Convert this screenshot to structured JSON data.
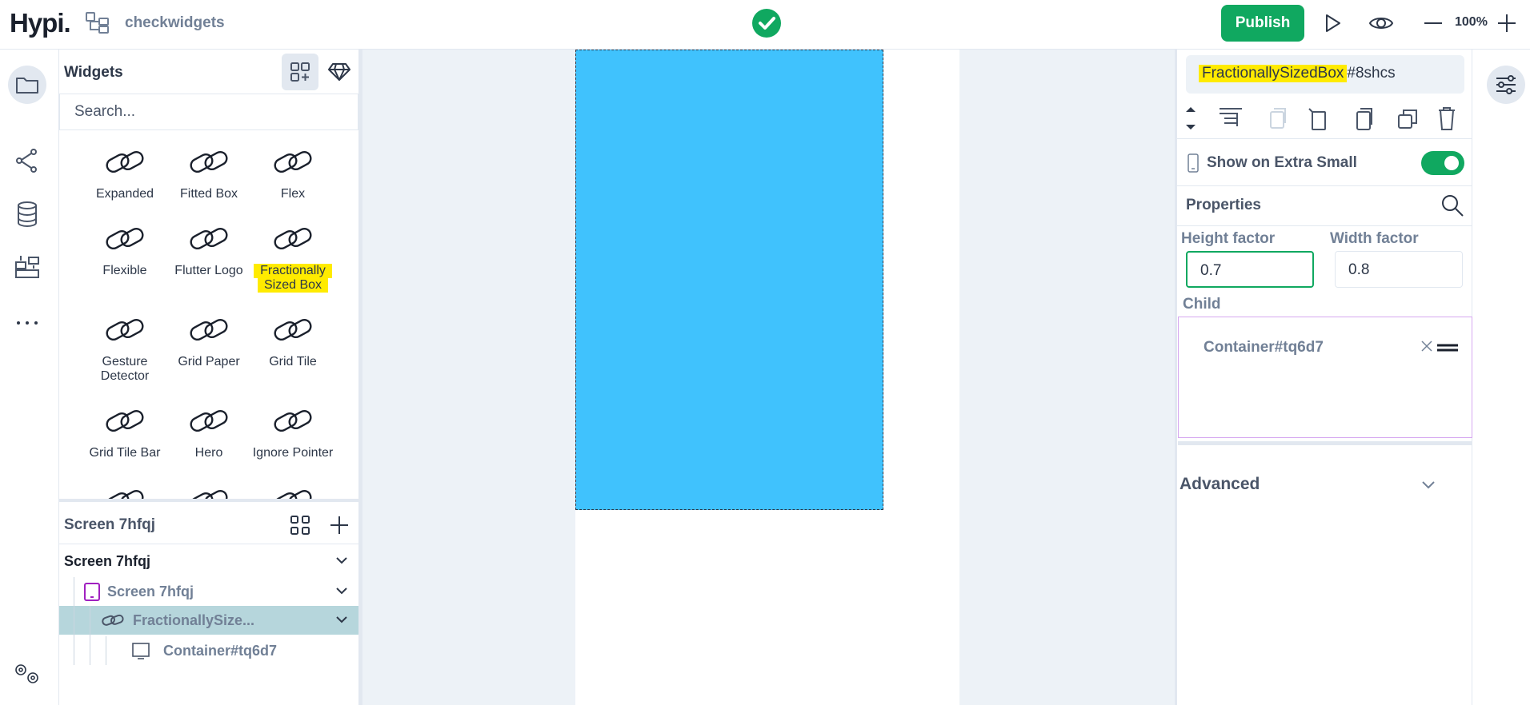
{
  "app": {
    "logo": "Hypi.",
    "project_name": "checkwidgets"
  },
  "topbar": {
    "publish_label": "Publish",
    "zoom_label": "100%"
  },
  "widgets_panel": {
    "title": "Widgets",
    "search_placeholder": "Search...",
    "items": [
      {
        "label": "Expanded"
      },
      {
        "label": "Fitted Box"
      },
      {
        "label": "Flex"
      },
      {
        "label": "Flexible"
      },
      {
        "label": "Flutter Logo"
      },
      {
        "label_line1": "Fractionally",
        "label_line2": "Sized Box",
        "highlighted": true
      },
      {
        "label_line1": "Gesture",
        "label_line2": "Detector"
      },
      {
        "label": "Grid Paper"
      },
      {
        "label": "Grid Tile"
      },
      {
        "label": "Grid Tile Bar"
      },
      {
        "label": "Hero"
      },
      {
        "label": "Ignore Pointer"
      }
    ]
  },
  "screens_panel": {
    "title": "Screen 7hfqj",
    "tree": [
      {
        "label": "Screen 7hfqj",
        "level": 0
      },
      {
        "label": "Screen 7hfqj",
        "level": 1
      },
      {
        "label": "FractionallySize...",
        "level": 2,
        "selected": true
      },
      {
        "label": "Container#tq6d7",
        "level": 3
      }
    ]
  },
  "canvas": {
    "box_color": "#40c2fd"
  },
  "properties_panel": {
    "widget_name_highlight": "FractionallySizedBox",
    "widget_name_suffix": "#8shcs",
    "show_on_label": "Show on Extra Small",
    "show_on_enabled": true,
    "properties_label": "Properties",
    "height_factor_label": "Height factor",
    "height_factor_value": "0.7",
    "width_factor_label": "Width factor",
    "width_factor_value": "0.8",
    "child_label": "Child",
    "child_value": "Container#tq6d7",
    "advanced_label": "Advanced"
  },
  "colors": {
    "accent": "#10a860",
    "highlight": "#ffeb00",
    "selected_row": "#b6d6dc"
  }
}
